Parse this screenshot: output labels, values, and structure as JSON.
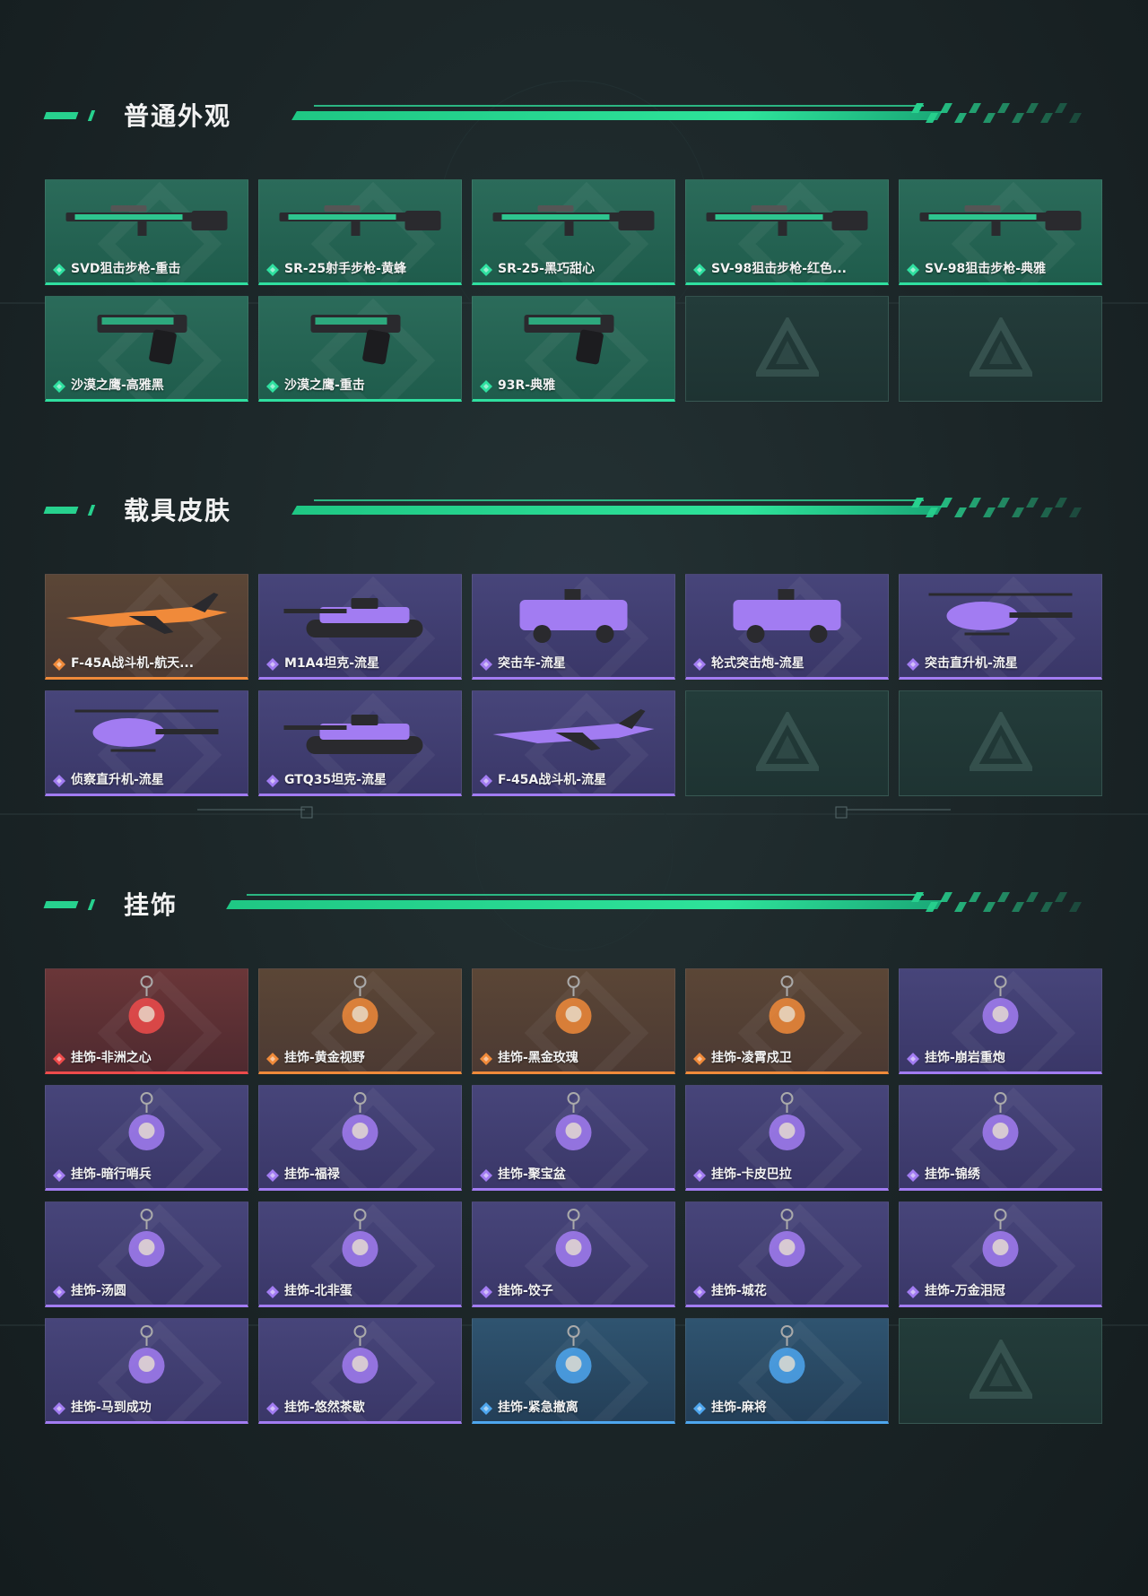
{
  "sections": [
    {
      "title": "普通外观",
      "items": [
        {
          "label": "SVD狙击步枪-重击",
          "rarity": "green",
          "icon": "rifle-icon"
        },
        {
          "label": "SR-25射手步枪-黄蜂",
          "rarity": "green",
          "icon": "rifle-icon"
        },
        {
          "label": "SR-25-黑巧甜心",
          "rarity": "green",
          "icon": "rifle-icon"
        },
        {
          "label": "SV-98狙击步枪-红色...",
          "rarity": "green",
          "icon": "rifle-icon"
        },
        {
          "label": "SV-98狙击步枪-典雅",
          "rarity": "green",
          "icon": "rifle-icon"
        },
        {
          "label": "沙漠之鹰-高雅黑",
          "rarity": "green",
          "icon": "pistol-icon"
        },
        {
          "label": "沙漠之鹰-重击",
          "rarity": "green",
          "icon": "pistol-icon"
        },
        {
          "label": "93R-典雅",
          "rarity": "green",
          "icon": "pistol-icon"
        }
      ],
      "empty_slots": 2
    },
    {
      "title": "载具皮肤",
      "items": [
        {
          "label": "F-45A战斗机-航天...",
          "rarity": "orange",
          "icon": "jet-icon"
        },
        {
          "label": "M1A4坦克-流星",
          "rarity": "purple",
          "icon": "tank-icon"
        },
        {
          "label": "突击车-流星",
          "rarity": "purple",
          "icon": "truck-icon"
        },
        {
          "label": "轮式突击炮-流星",
          "rarity": "purple",
          "icon": "truck-icon"
        },
        {
          "label": "突击直升机-流星",
          "rarity": "purple",
          "icon": "helicopter-icon"
        },
        {
          "label": "侦察直升机-流星",
          "rarity": "purple",
          "icon": "helicopter-icon"
        },
        {
          "label": "GTQ35坦克-流星",
          "rarity": "purple",
          "icon": "tank-icon"
        },
        {
          "label": "F-45A战斗机-流星",
          "rarity": "purple",
          "icon": "jet-icon"
        }
      ],
      "empty_slots": 2
    },
    {
      "title": "挂饰",
      "items": [
        {
          "label": "挂饰-非洲之心",
          "rarity": "red",
          "icon": "charm-icon"
        },
        {
          "label": "挂饰-黄金视野",
          "rarity": "orange",
          "icon": "charm-icon"
        },
        {
          "label": "挂饰-黑金玫瑰",
          "rarity": "orange",
          "icon": "charm-icon"
        },
        {
          "label": "挂饰-凌霄戍卫",
          "rarity": "orange",
          "icon": "charm-icon"
        },
        {
          "label": "挂饰-崩岩重炮",
          "rarity": "purple",
          "icon": "charm-icon"
        },
        {
          "label": "挂饰-暗行哨兵",
          "rarity": "purple",
          "icon": "charm-icon"
        },
        {
          "label": "挂饰-福禄",
          "rarity": "purple",
          "icon": "charm-icon"
        },
        {
          "label": "挂饰-聚宝盆",
          "rarity": "purple",
          "icon": "charm-icon"
        },
        {
          "label": "挂饰-卡皮巴拉",
          "rarity": "purple",
          "icon": "charm-icon"
        },
        {
          "label": "挂饰-锦绣",
          "rarity": "purple",
          "icon": "charm-icon"
        },
        {
          "label": "挂饰-汤圆",
          "rarity": "purple",
          "icon": "charm-icon"
        },
        {
          "label": "挂饰-北非蛋",
          "rarity": "purple",
          "icon": "charm-icon"
        },
        {
          "label": "挂饰-饺子",
          "rarity": "purple",
          "icon": "charm-icon"
        },
        {
          "label": "挂饰-城花",
          "rarity": "purple",
          "icon": "charm-icon"
        },
        {
          "label": "挂饰-万金泪冠",
          "rarity": "purple",
          "icon": "charm-icon"
        },
        {
          "label": "挂饰-马到成功",
          "rarity": "purple",
          "icon": "charm-icon"
        },
        {
          "label": "挂饰-悠然茶歇",
          "rarity": "purple",
          "icon": "charm-icon"
        },
        {
          "label": "挂饰-紧急撤离",
          "rarity": "blue",
          "icon": "charm-icon"
        },
        {
          "label": "挂饰-麻将",
          "rarity": "blue",
          "icon": "charm-icon"
        }
      ],
      "empty_slots": 1
    }
  ],
  "colors": {
    "accent": "#27d18e",
    "green": "#2fe0a0",
    "purple": "#a27cf2",
    "orange": "#f08a3a",
    "red": "#ee4b4b",
    "blue": "#4ea6ee"
  }
}
